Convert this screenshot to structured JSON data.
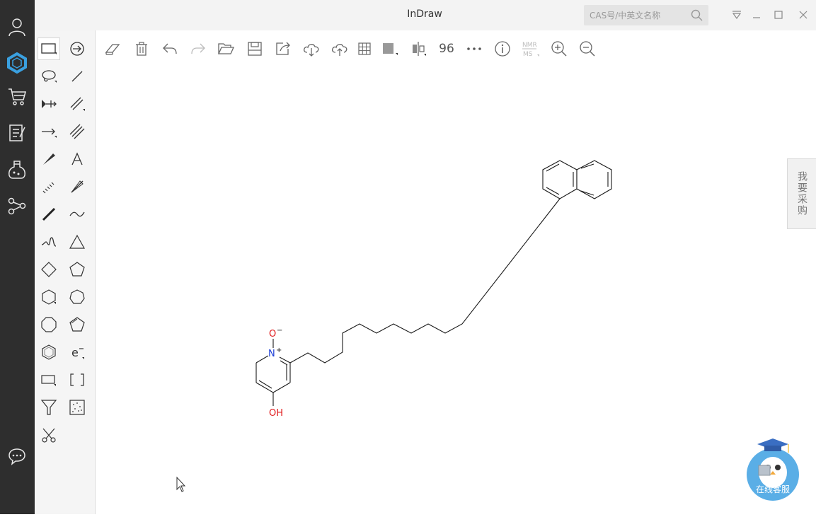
{
  "app": {
    "title": "InDraw"
  },
  "search": {
    "placeholder": "CAS号/中英文名称"
  },
  "left_rail": {
    "items": [
      "user-icon",
      "indraw-logo-icon",
      "shopping-cart-icon",
      "notes-icon",
      "flask-icon",
      "network-icon",
      "chat-icon"
    ],
    "accent_color": "#3aa0e0",
    "background": "#2e2e2e"
  },
  "toolbar": {
    "zoom_value": "96",
    "icons": [
      "eraser-icon",
      "trash-icon",
      "undo-icon",
      "redo-icon",
      "open-folder-icon",
      "save-icon",
      "export-icon",
      "cloud-download-icon",
      "cloud-upload-icon",
      "grid-icon",
      "fill-color-icon",
      "align-icon",
      "zoom-level",
      "more-icon",
      "info-icon",
      "nmr-ms-icon",
      "zoom-in-icon",
      "zoom-out-icon"
    ],
    "nmr_top": "NMR",
    "nmr_bottom": "MS"
  },
  "tool_panel": {
    "tools": [
      "rect-select",
      "rotate",
      "lasso-select",
      "single-bond",
      "move",
      "double-bond",
      "arrow",
      "triple-bond",
      "wedge-bond",
      "text",
      "hashed-bond",
      "hashed-wedge",
      "bold-bond",
      "wavy-bond",
      "squiggle",
      "triangle",
      "diamond",
      "pentagon",
      "hexagon",
      "heptagon",
      "octagon",
      "pentagon-alt",
      "benzene",
      "electron",
      "rectangle",
      "brackets",
      "funnel",
      "dotted-box",
      "scissors"
    ]
  },
  "molecule": {
    "atoms": {
      "o_minus": "O",
      "o_charge": "−",
      "n_plus": "N",
      "n_charge": "+",
      "oh": "OH"
    },
    "colors": {
      "oxygen": "#e0191b",
      "nitrogen": "#1a3cd6",
      "bond": "#1a1a1a"
    }
  },
  "purchase_tab": {
    "label": "我要采购"
  },
  "support": {
    "label": "在线客服"
  }
}
